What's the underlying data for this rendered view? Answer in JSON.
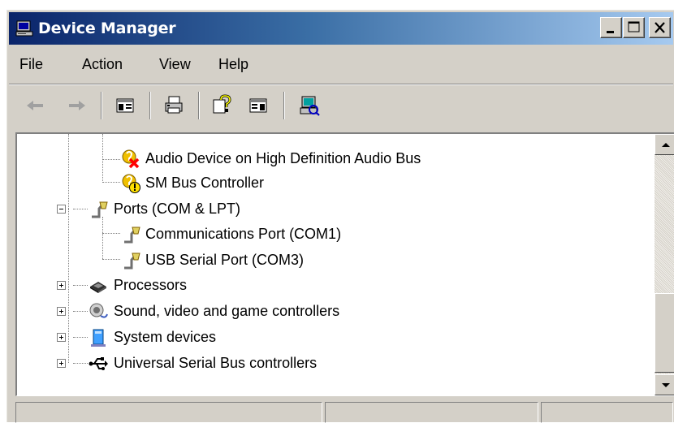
{
  "window": {
    "title": "Device Manager"
  },
  "menubar": {
    "items": [
      "File",
      "Action",
      "View",
      "Help"
    ]
  },
  "toolbar": {
    "buttons": [
      "back-icon",
      "forward-icon",
      "show-hide-console-tree-icon",
      "print-icon",
      "help-icon",
      "show-hide-action-pane-icon",
      "scan-hardware-icon"
    ]
  },
  "tree": {
    "nodes": [
      {
        "label": "Audio Device on High Definition Audio Bus",
        "icon": "audio-device-error-icon"
      },
      {
        "label": "SM Bus Controller",
        "icon": "warning-device-icon"
      },
      {
        "label": "Ports (COM & LPT)",
        "icon": "port-icon",
        "state": "expanded"
      },
      {
        "label": "Communications Port (COM1)",
        "icon": "port-icon"
      },
      {
        "label": "USB Serial Port (COM3)",
        "icon": "port-icon"
      },
      {
        "label": "Processors",
        "icon": "processor-icon",
        "state": "collapsed"
      },
      {
        "label": "Sound, video and game controllers",
        "icon": "sound-icon",
        "state": "collapsed"
      },
      {
        "label": "System devices",
        "icon": "system-devices-icon",
        "state": "collapsed"
      },
      {
        "label": "Universal Serial Bus controllers",
        "icon": "usb-icon",
        "state": "collapsed"
      }
    ]
  },
  "statusbar": {
    "panes": [
      "",
      "",
      ""
    ]
  },
  "colors": {
    "titlebar_start": "#0a246a",
    "titlebar_end": "#a6caf0",
    "face": "#d4d0c8"
  }
}
